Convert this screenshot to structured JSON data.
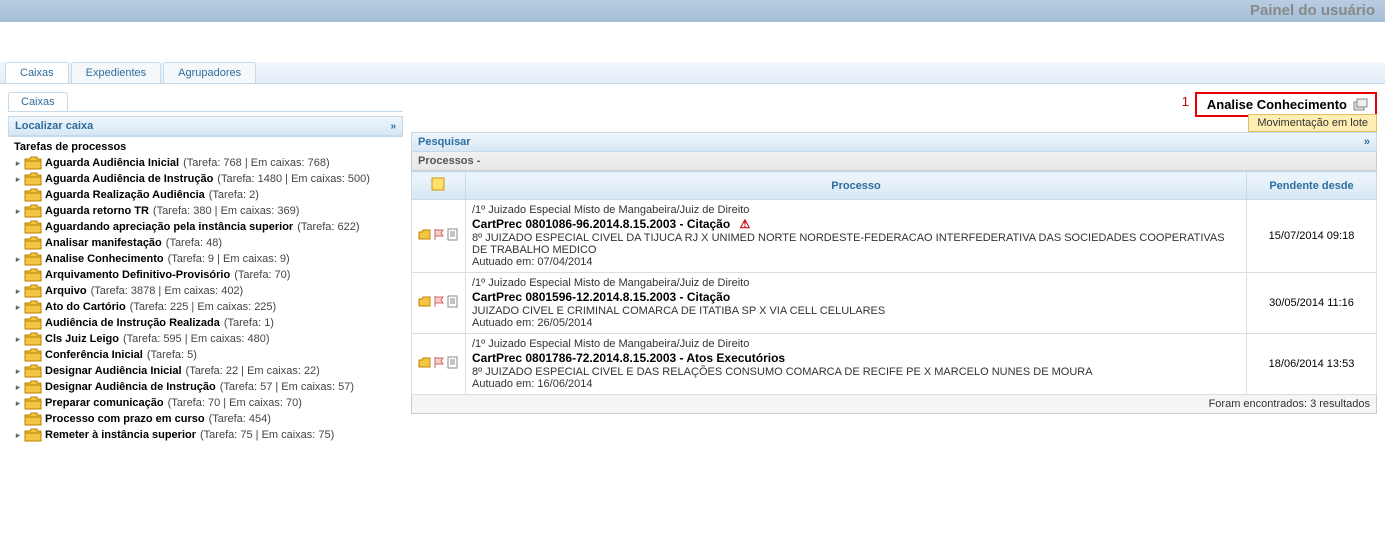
{
  "header": {
    "title": "Painel do usuário"
  },
  "tabs": {
    "items": [
      "Caixas",
      "Expedientes",
      "Agrupadores"
    ],
    "active": 0
  },
  "left": {
    "sub_tab": "Caixas",
    "locate": {
      "label": "Localizar caixa",
      "expand": "»"
    },
    "tasks_title": "Tarefas de processos",
    "items": [
      {
        "expandable": true,
        "label": "Aguarda Audiência Inicial",
        "suffix": "(Tarefa: 768 | Em caixas: 768)"
      },
      {
        "expandable": true,
        "label": "Aguarda Audiência de Instrução",
        "suffix": "(Tarefa: 1480 | Em caixas: 500)"
      },
      {
        "expandable": false,
        "label": "Aguarda Realização Audiência",
        "suffix": "(Tarefa: 2)"
      },
      {
        "expandable": true,
        "label": "Aguarda retorno TR",
        "suffix": "(Tarefa: 380 | Em caixas: 369)"
      },
      {
        "expandable": false,
        "label": "Aguardando apreciação pela instância superior",
        "suffix": "(Tarefa: 622)"
      },
      {
        "expandable": false,
        "label": "Analisar manifestação",
        "suffix": "(Tarefa: 48)"
      },
      {
        "expandable": true,
        "label": "Analise Conhecimento",
        "suffix": "(Tarefa: 9 | Em caixas: 9)"
      },
      {
        "expandable": false,
        "label": "Arquivamento Definitivo-Provisório",
        "suffix": "(Tarefa: 70)"
      },
      {
        "expandable": true,
        "label": "Arquivo",
        "suffix": "(Tarefa: 3878 | Em caixas: 402)"
      },
      {
        "expandable": true,
        "label": "Ato do Cartório",
        "suffix": "(Tarefa: 225 | Em caixas: 225)"
      },
      {
        "expandable": false,
        "label": "Audiência de Instrução Realizada",
        "suffix": "(Tarefa: 1)"
      },
      {
        "expandable": true,
        "label": "Cls Juiz Leigo",
        "suffix": "(Tarefa: 595 | Em caixas: 480)"
      },
      {
        "expandable": false,
        "label": "Conferência Inicial",
        "suffix": "(Tarefa: 5)"
      },
      {
        "expandable": true,
        "label": "Designar Audiência Inicial",
        "suffix": "(Tarefa: 22 | Em caixas: 22)"
      },
      {
        "expandable": true,
        "label": "Designar Audiência de Instrução",
        "suffix": "(Tarefa: 57 | Em caixas: 57)"
      },
      {
        "expandable": true,
        "label": "Preparar comunicação",
        "suffix": "(Tarefa: 70 | Em caixas: 70)"
      },
      {
        "expandable": false,
        "label": "Processo com prazo em curso",
        "suffix": "(Tarefa: 454)"
      },
      {
        "expandable": true,
        "label": "Remeter à instância superior",
        "suffix": "(Tarefa: 75 | Em caixas: 75)"
      }
    ]
  },
  "right": {
    "annotation_num": "1",
    "current_task": "Analise Conhecimento",
    "tooltip": "Movimentação em lote",
    "search_label": "Pesquisar",
    "search_expand": "»",
    "processos_label": "Processos -",
    "columns": {
      "processo": "Processo",
      "pendente": "Pendente desde"
    },
    "rows": [
      {
        "court": "/1º Juizado Especial Misto de Mangabeira/Juiz de Direito",
        "num": "CartPrec 0801086-96.2014.8.15.2003 - Citação",
        "parties": "8º JUIZADO ESPECIAL CIVEL DA TIJUCA RJ X UNIMED NORTE NORDESTE-FEDERACAO INTERFEDERATIVA DAS SOCIEDADES COOPERATIVAS DE TRABALHO MEDICO",
        "dated": "Autuado em: 07/04/2014",
        "pending": "15/07/2014 09:18",
        "warn": true
      },
      {
        "court": "/1º Juizado Especial Misto de Mangabeira/Juiz de Direito",
        "num": "CartPrec 0801596-12.2014.8.15.2003 - Citação",
        "parties": "JUIZADO CIVEL E CRIMINAL COMARCA DE ITATIBA SP X VIA CELL CELULARES",
        "dated": "Autuado em: 26/05/2014",
        "pending": "30/05/2014 11:16",
        "warn": false
      },
      {
        "court": "/1º Juizado Especial Misto de Mangabeira/Juiz de Direito",
        "num": "CartPrec 0801786-72.2014.8.15.2003 - Atos Executórios",
        "parties": "8º JUIZADO ESPECIAL CIVEL E DAS RELAÇÕES CONSUMO COMARCA DE RECIFE PE X MARCELO NUNES DE MOURA",
        "dated": "Autuado em: 16/06/2014",
        "pending": "18/06/2014 13:53",
        "warn": false
      }
    ],
    "footer": "Foram encontrados: 3 resultados"
  },
  "icons": {
    "folder": "folder-icon",
    "batch": "batch-move-icon",
    "note": "sticky-note-icon",
    "warn": "warning-icon"
  }
}
